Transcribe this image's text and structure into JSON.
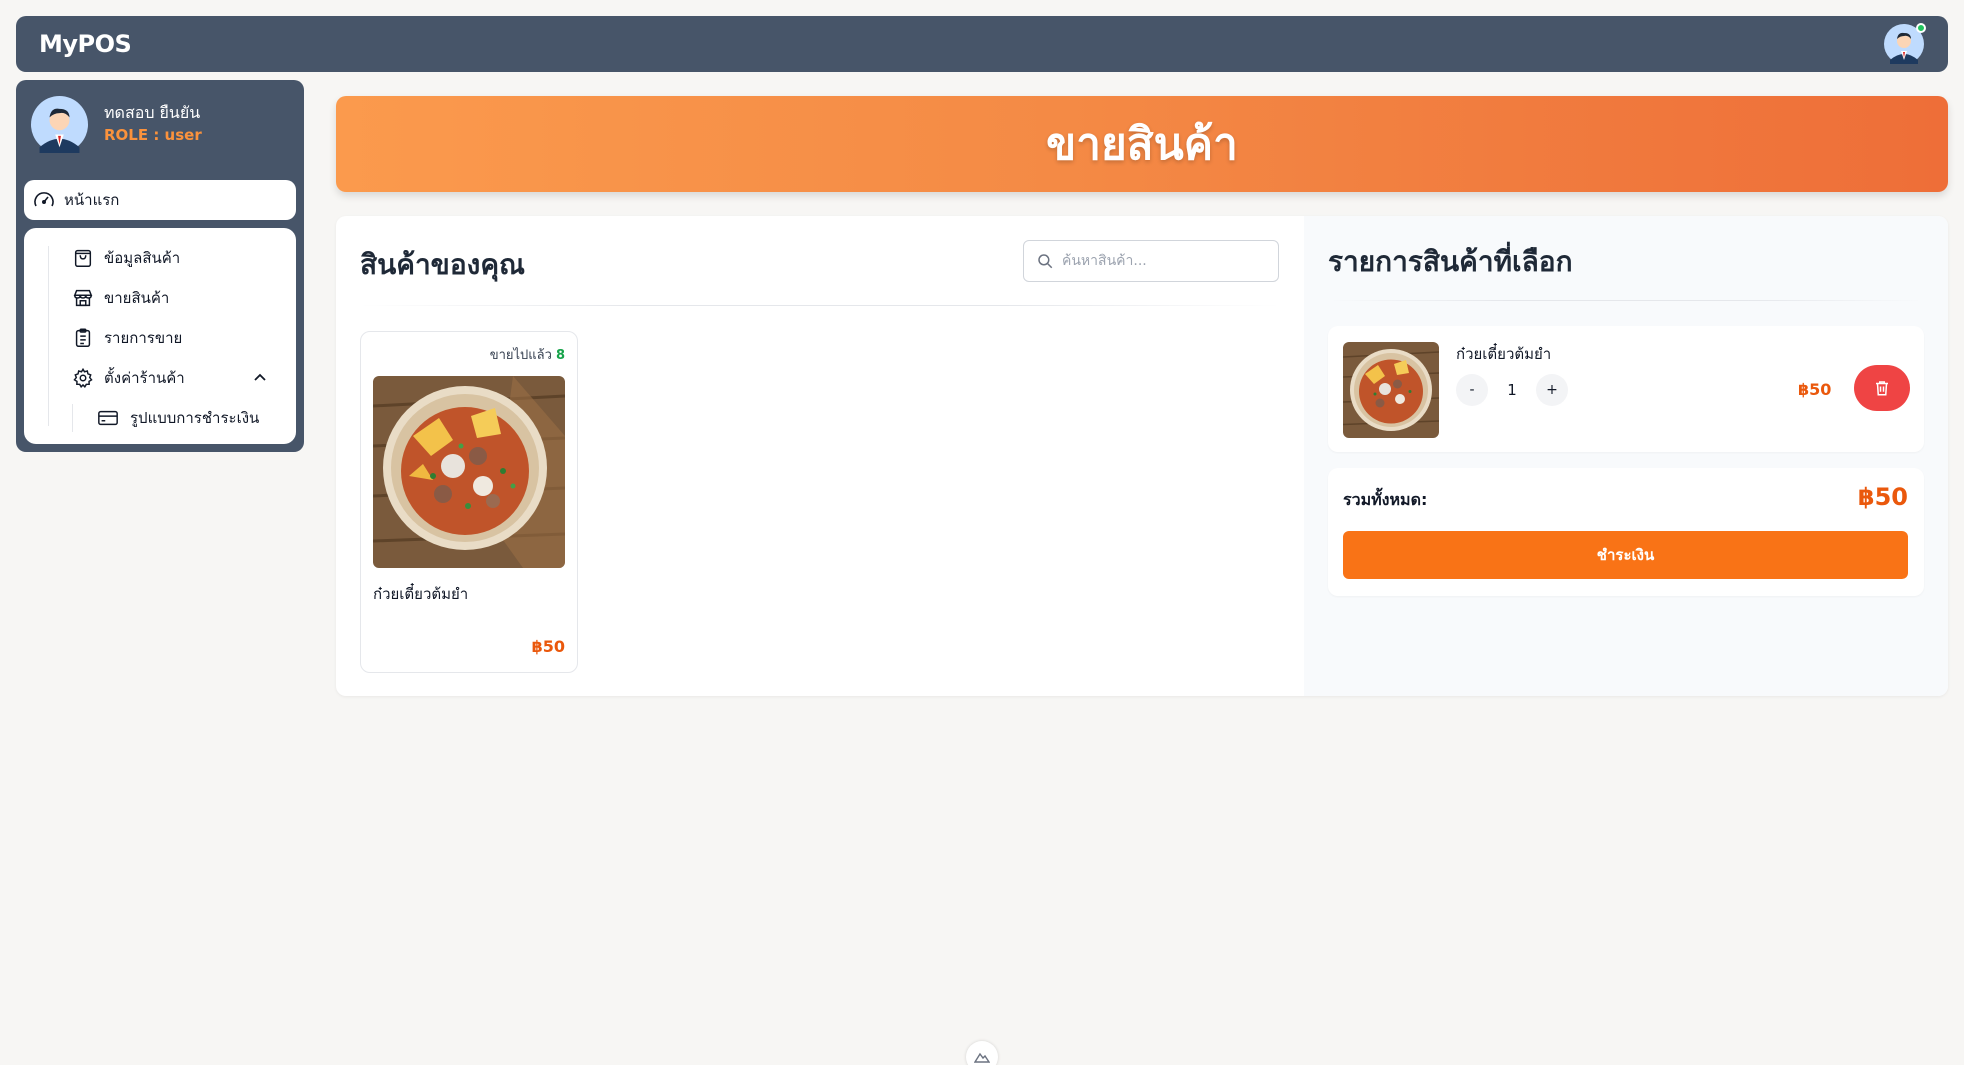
{
  "app": {
    "brand": "MyPOS"
  },
  "user": {
    "name": "ทดสอบ ยืนยัน",
    "role": "ROLE : user"
  },
  "sidebar": {
    "home": "หน้าแรก",
    "items": [
      {
        "label": "ข้อมูลสินค้า",
        "icon": "bag-icon"
      },
      {
        "label": "ขายสินค้า",
        "icon": "store-icon"
      },
      {
        "label": "รายการขาย",
        "icon": "clipboard-list-icon"
      },
      {
        "label": "ตั้งค่าร้านค้า",
        "icon": "gear-icon"
      }
    ],
    "sub_items": [
      {
        "label": "รูปแบบการชำระเงิน",
        "icon": "credit-card-icon"
      }
    ]
  },
  "banner": {
    "title": "ขายสินค้า"
  },
  "products": {
    "heading": "สินค้าของคุณ",
    "search_placeholder": "ค้นหาสินค้า...",
    "items": [
      {
        "sold_label": "ขายไปแล้ว",
        "sold_count": "8",
        "name": "ก๋วยเตี๋ยวต้มยำ",
        "price": "฿50"
      }
    ]
  },
  "cart": {
    "heading": "รายการสินค้าที่เลือก",
    "items": [
      {
        "name": "ก๋วยเตี๋ยวต้มยำ",
        "qty": "1",
        "minus": "-",
        "plus": "+",
        "price": "฿50"
      }
    ],
    "total_label": "รวมทั้งหมด:",
    "total_value": "฿50",
    "pay_label": "ชำระเงิน"
  },
  "colors": {
    "navbar": "#475569",
    "accent": "#f97316",
    "price": "#ea580c",
    "danger": "#ef4444",
    "success": "#16a34a"
  }
}
